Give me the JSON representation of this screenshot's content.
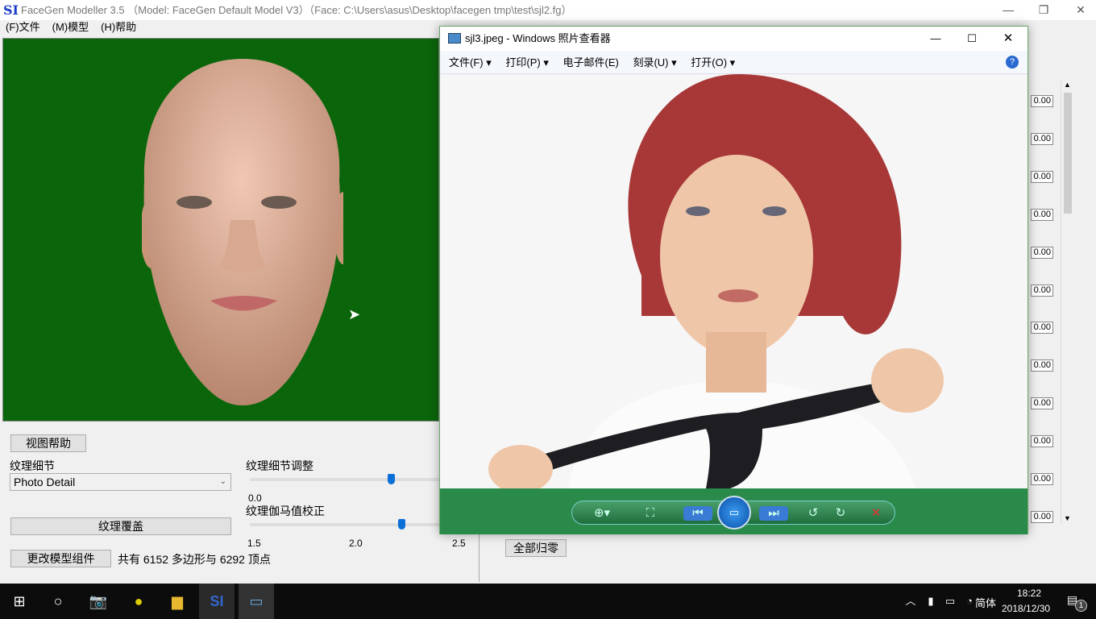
{
  "app": {
    "logo": "SI",
    "title": "FaceGen Modeller 3.5 （Model: FaceGen Default Model V3）（Face: C:\\Users\\asus\\Desktop\\facegen tmp\\test\\sjl2.fg）",
    "menu": [
      "(F)文件",
      "(M)模型",
      "(H)帮助"
    ]
  },
  "controls": {
    "view_help": "视图帮助",
    "texture_detail_label": "纹理细节",
    "texture_detail_value": "Photo Detail",
    "texture_overlay": "纹理覆盖",
    "change_model": "更改模型组件",
    "stats": "共有 6152 多边形与 6292 顶点",
    "detail_adjust_label": "纹理细节调整",
    "detail_adjust_min": "0.0",
    "detail_adjust_fraction": 0.73,
    "gamma_label": "纹理伽马值校正",
    "gamma_ticks": [
      "1.5",
      "2.0",
      "2.5"
    ],
    "gamma_value": 2.22,
    "reset_all": "全部归零",
    "values": [
      "0.00",
      "0.00",
      "0.00",
      "0.00",
      "0.00",
      "0.00",
      "0.00",
      "0.00",
      "0.00",
      "0.00",
      "0.00",
      "0.00"
    ]
  },
  "viewer": {
    "title": "sjl3.jpeg - Windows 照片查看器",
    "menu": [
      "文件(F)",
      "打印(P)",
      "电子邮件(E)",
      "刻录(U)",
      "打开(O)"
    ],
    "menu_has_dropdown": [
      true,
      true,
      false,
      true,
      true
    ],
    "controls": [
      "zoom-icon",
      "fit-icon",
      "previous-icon",
      "slideshow-icon",
      "next-icon",
      "rotate-left-icon",
      "rotate-right-icon",
      "delete-icon"
    ]
  },
  "taskbar": {
    "time": "18:22",
    "date": "2018/12/30",
    "ime": "简体",
    "notifications": "1"
  }
}
